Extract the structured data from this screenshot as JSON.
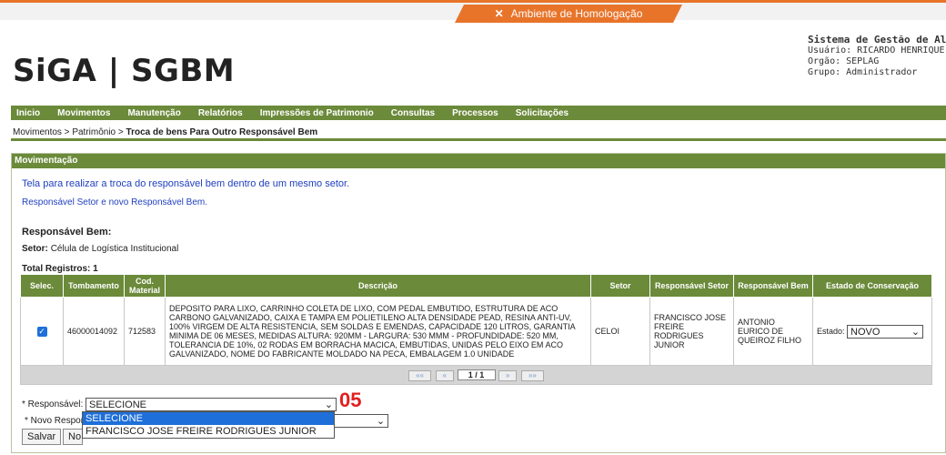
{
  "env": {
    "label": "Ambiente de Homologação",
    "icon": "tools-icon"
  },
  "logo": "SiGA | SGBM",
  "system": {
    "title": "Sistema de Gestão de Almo",
    "user": "Usuário: RICARDO HENRIQUE",
    "org": "Orgão: SEPLAG",
    "group": "Grupo: Administrador"
  },
  "menu": [
    "Inicio",
    "Movimentos",
    "Manutenção",
    "Relatórios",
    "Impressões de Patrimonio",
    "Consultas",
    "Processos",
    "Solicitações"
  ],
  "breadcrumb": {
    "part1": "Movimentos",
    "part2": "Patrimônio",
    "current": "Troca de bens Para Outro Responsável Bem"
  },
  "panel": {
    "title": "Movimentação",
    "intro": "Tela para realizar a troca do responsável bem dentro de um mesmo setor.",
    "subtitle": "Responsável Setor e novo Responsável Bem.",
    "responsavel_label": "Responsável Bem:",
    "setor_label": "Setor:",
    "setor_value": "Célula de Logística Institucional",
    "total": "Total Registros: 1"
  },
  "table": {
    "headers": [
      "Selec.",
      "Tombamento",
      "Cod. Material",
      "Descrição",
      "Setor",
      "Responsável Setor",
      "Responsável Bem",
      "Estado de Conservação"
    ],
    "row": {
      "checked": true,
      "tombamento": "46000014092",
      "cod": "712583",
      "descricao": "DEPOSITO PARA LIXO, CARRINHO COLETA DE LIXO, COM PEDAL EMBUTIDO, ESTRUTURA DE ACO CARBONO GALVANIZADO, CAIXA E TAMPA EM POLIETILENO ALTA DENSIDADE PEAD, RESINA ANTI-UV, 100% VIRGEM DE ALTA RESISTENCIA, SEM SOLDAS E EMENDAS, CAPACIDADE 120 LITROS, GARANTIA MINIMA DE 06 MESES, MEDIDAS ALTURA: 920MM - LARGURA: 530 MMM - PROFUNDIDADE: 520 MM, TOLERANCIA DE 10%, 02 RODAS EM BORRACHA MACICA, EMBUTIDAS, UNIDAS PELO EIXO EM ACO GALVANIZADO, NOME DO FABRICANTE MOLDADO NA PECA, EMBALAGEM 1.0 UNIDADE",
      "setor": "CELOI",
      "resp_setor": "FRANCISCO JOSE FREIRE RODRIGUES JUNIOR",
      "resp_bem": "ANTONIO EURICO DE QUEIROZ FILHO",
      "estado_label": "Estado:",
      "estado_value": "NOVO"
    },
    "pager": {
      "first": "«« ",
      "prev": "«",
      "page": "1 / 1",
      "next": "»",
      "last": "»»"
    }
  },
  "form": {
    "responsavel_label": "* Responsável:",
    "responsavel_value": "SELECIONE",
    "novo_label": "* Novo Respon",
    "options": [
      "SELECIONE",
      "FRANCISCO JOSE FREIRE RODRIGUES JUNIOR"
    ],
    "annotation": "05",
    "save": "Salvar",
    "new": "No"
  }
}
